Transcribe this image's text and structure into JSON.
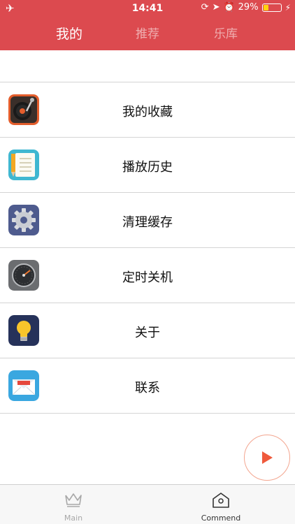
{
  "status_bar": {
    "time": "14:41",
    "battery": "29%",
    "battery_level": 0.29
  },
  "header": {
    "tabs": [
      {
        "label": "我的"
      },
      {
        "label": "推荐"
      },
      {
        "label": "乐库"
      }
    ]
  },
  "menu": {
    "items": [
      {
        "label": "我的收藏",
        "icon": "turntable-icon"
      },
      {
        "label": "播放历史",
        "icon": "notepad-pencil-icon"
      },
      {
        "label": "清理缓存",
        "icon": "gear-icon"
      },
      {
        "label": "定时关机",
        "icon": "gauge-icon"
      },
      {
        "label": "关于",
        "icon": "lightbulb-icon"
      },
      {
        "label": "联系",
        "icon": "envelope-icon"
      }
    ]
  },
  "tabbar": {
    "items": [
      {
        "label": "Main",
        "icon": "crown-icon"
      },
      {
        "label": "Commend",
        "icon": "house-icon"
      }
    ]
  },
  "colors": {
    "header": "#dc4a4f",
    "accent": "#ef5a3c"
  }
}
